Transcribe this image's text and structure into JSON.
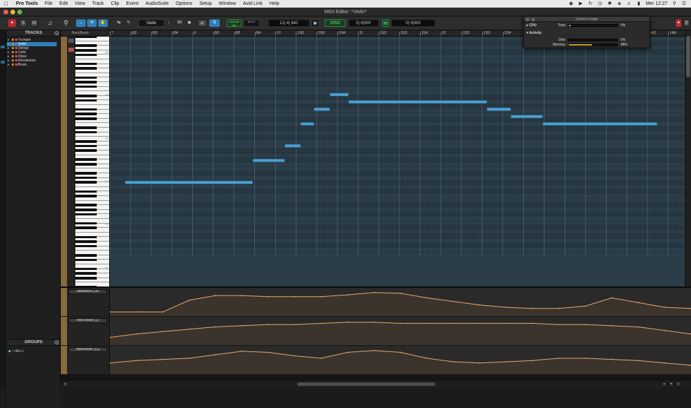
{
  "menubar": {
    "app_name": "Pro Tools",
    "items": [
      "File",
      "Edit",
      "View",
      "Track",
      "Clip",
      "Event",
      "AudioSuite",
      "Options",
      "Setup",
      "Window",
      "Avid Link",
      "Help"
    ],
    "clock": "Mer 12:27"
  },
  "window": {
    "title": "MIDI Editor: *Violin*"
  },
  "toolbar": {
    "record_label": "●",
    "solo_label": "S",
    "mute_label": "M",
    "track_selector": "Violin",
    "velocity_value": "80",
    "mode_top": "NUDGE VAL",
    "mode_btm": "SPOT",
    "grid_label": "GRID",
    "counter_main": "12| 4| 840",
    "counter_sub": "0| 0|000",
    "counter_right": "0| 0|000",
    "view_label": "Bar"
  },
  "tracks_panel": {
    "header": "TRACKS",
    "tracks": [
      {
        "name": "Trumpet",
        "selected": false
      },
      {
        "name": "Violin",
        "selected": true
      },
      {
        "name": "Strings",
        "selected": false
      },
      {
        "name": "Cello",
        "selected": false
      },
      {
        "name": "Oboe",
        "selected": false
      },
      {
        "name": "Woodwinds",
        "selected": false
      },
      {
        "name": "Brass",
        "selected": false
      }
    ]
  },
  "groups_panel": {
    "header": "GROUPS",
    "items": [
      {
        "name": "<ALL>"
      }
    ]
  },
  "ruler": {
    "label": "Bars|Beats",
    "bars": [
      "7",
      "8|2",
      "8|3",
      "8|4",
      "9",
      "9|2",
      "9|3",
      "9|4",
      "10",
      "10|2",
      "10|3",
      "10|4",
      "11",
      "11|2",
      "11|3",
      "11|4",
      "12",
      "12|2",
      "12|3",
      "12|4",
      "13",
      "13|2",
      "13|3",
      "13|4",
      "14",
      "14|2",
      "14|3",
      "14|4"
    ]
  },
  "keyboard": {
    "octave_labels": [
      "C6",
      "C5",
      "C4",
      "C3",
      "C2",
      "C1"
    ]
  },
  "notes": [
    {
      "start": 0.0,
      "end": 0.24,
      "pitch": 30
    },
    {
      "start": 0.24,
      "end": 0.3,
      "pitch": 33
    },
    {
      "start": 0.3,
      "end": 0.33,
      "pitch": 35
    },
    {
      "start": 0.33,
      "end": 0.355,
      "pitch": 38
    },
    {
      "start": 0.355,
      "end": 0.385,
      "pitch": 40
    },
    {
      "start": 0.385,
      "end": 0.42,
      "pitch": 42
    },
    {
      "start": 0.42,
      "end": 0.68,
      "pitch": 41
    },
    {
      "start": 0.68,
      "end": 0.725,
      "pitch": 40
    },
    {
      "start": 0.725,
      "end": 0.785,
      "pitch": 39
    },
    {
      "start": 0.785,
      "end": 1.0,
      "pitch": 38
    }
  ],
  "controller_lanes": [
    {
      "name": "undefined (14)",
      "points": [
        0.15,
        0.15,
        0.15,
        0.65,
        0.85,
        0.85,
        0.8,
        0.8,
        0.8,
        0.88,
        0.98,
        0.95,
        0.75,
        0.6,
        0.45,
        0.35,
        0.3,
        0.3,
        0.4,
        0.75,
        0.55,
        0.35,
        0.3
      ]
    },
    {
      "name": "mod wheel (1)",
      "points": [
        0.3,
        0.45,
        0.55,
        0.65,
        0.75,
        0.8,
        0.85,
        0.85,
        0.9,
        0.95,
        0.95,
        0.9,
        0.9,
        0.9,
        0.9,
        0.9,
        0.9,
        0.85,
        0.85,
        0.8,
        0.75,
        0.6,
        0.45
      ]
    },
    {
      "name": "expression (11)",
      "points": [
        0.45,
        0.55,
        0.6,
        0.65,
        0.8,
        0.95,
        0.9,
        0.75,
        0.65,
        0.9,
        0.98,
        0.9,
        0.65,
        0.5,
        0.45,
        0.5,
        0.55,
        0.65,
        0.65,
        0.6,
        0.55,
        0.45,
        0.35
      ]
    }
  ],
  "system_usage": {
    "title": "System Usage",
    "cpu_section": "CPU",
    "cpu_label": "Total",
    "cpu_value": "4%",
    "cpu_fraction": 0.04,
    "activity_section": "Activity",
    "disk_label": "Disk",
    "disk_value": "0%",
    "disk_fraction": 0.0,
    "memory_label": "Memory",
    "memory_value": "48%",
    "memory_fraction": 0.48
  },
  "colors": {
    "note": "#4b9fcf",
    "note_border": "#1f4f6b",
    "grid_bg": "#2b3d49",
    "curve": "#e9a86a",
    "curve_fill": "#3b342c",
    "track_color": "#d87c2c"
  }
}
